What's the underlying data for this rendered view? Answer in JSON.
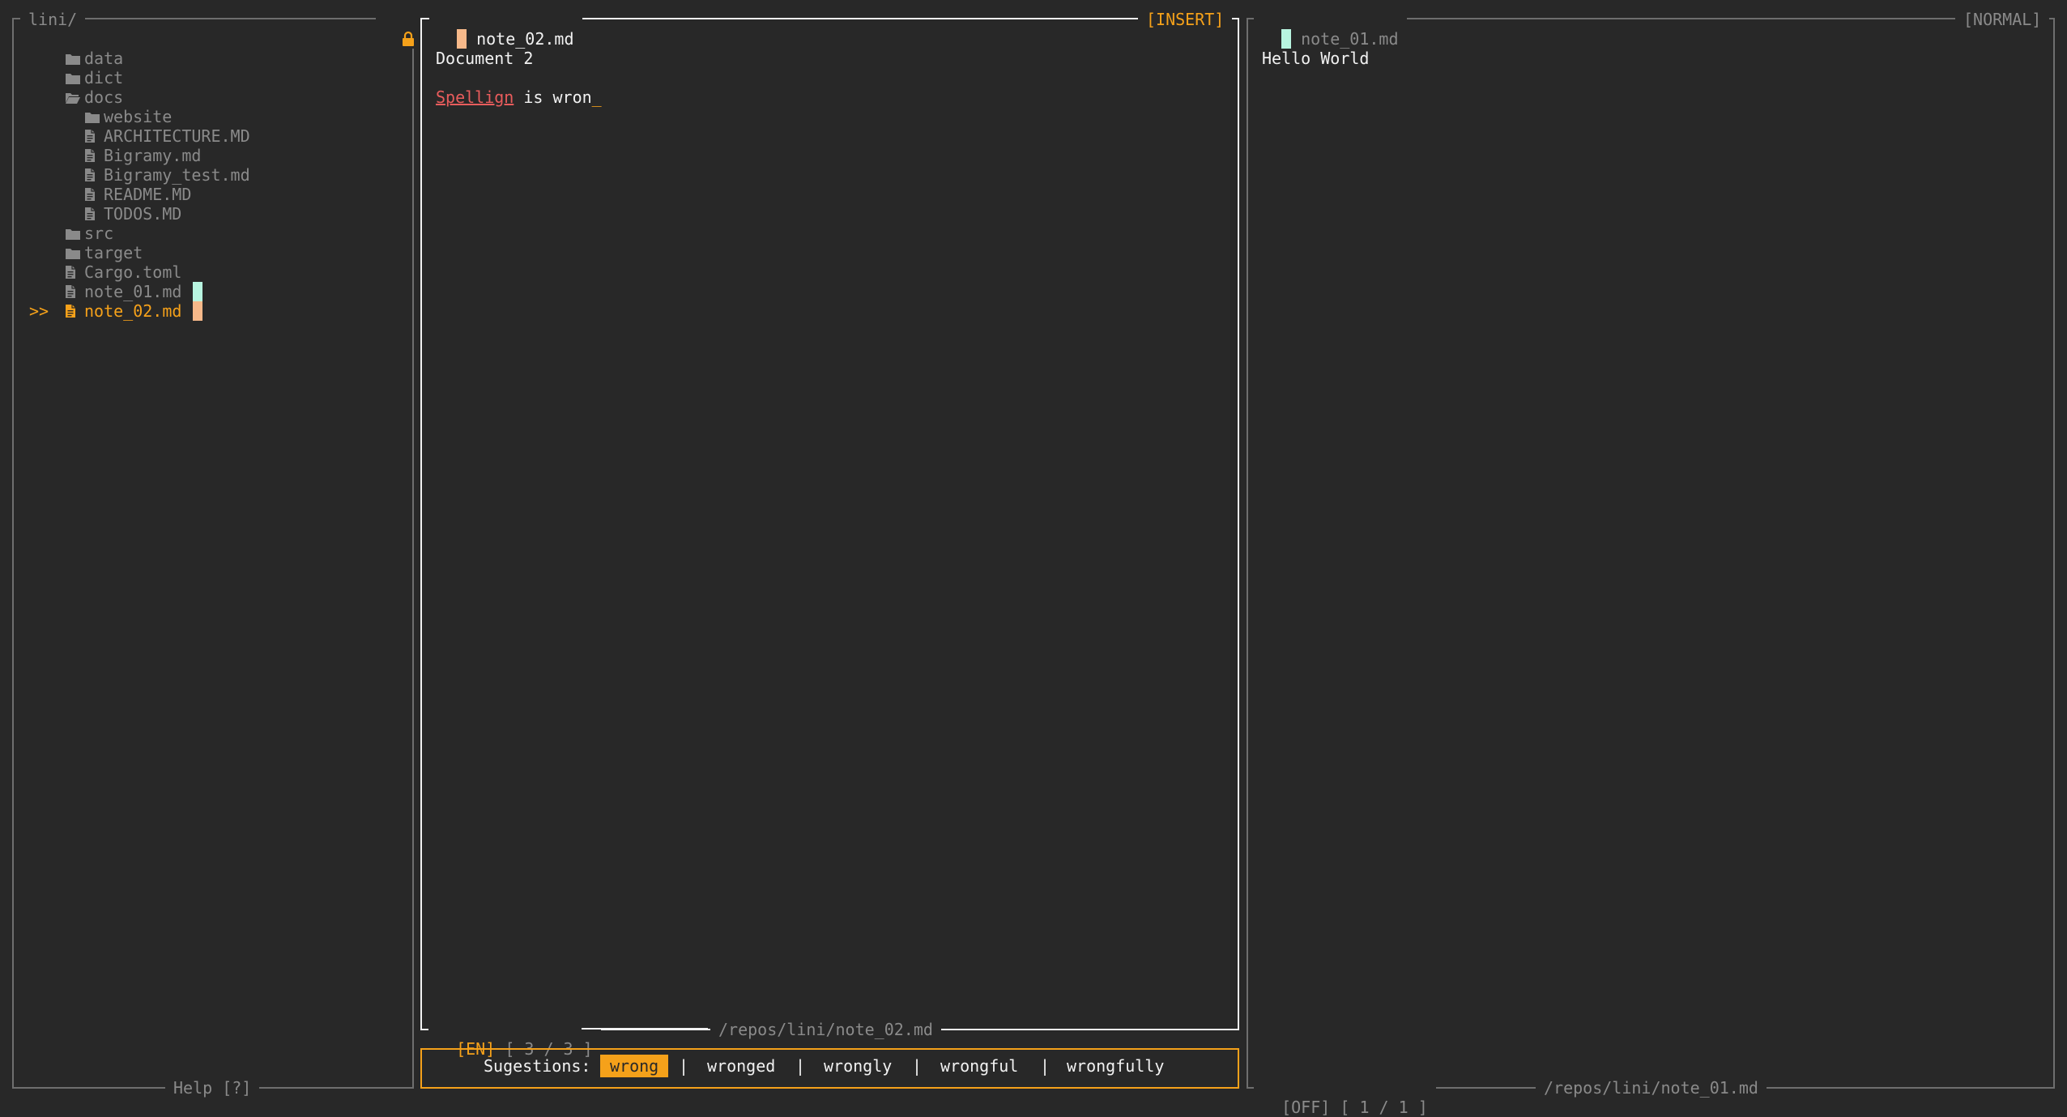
{
  "colors": {
    "background": "#282828",
    "accent": "#f5a11a",
    "text": "#f2f2f2",
    "dim": "#8a8a8a",
    "border_dim": "#6e6e6e",
    "marker_mint": "#b8f5e0",
    "marker_peach": "#f7b98a",
    "spell_error": "#e85c5c"
  },
  "explorer": {
    "title": "lini/",
    "lock_icon": "lock-icon",
    "help": "Help [?]",
    "selection_marker": ">>",
    "items": [
      {
        "name": "data",
        "type": "folder"
      },
      {
        "name": "dict",
        "type": "folder"
      },
      {
        "name": "docs",
        "type": "folder-open"
      },
      {
        "name": "website",
        "type": "folder"
      },
      {
        "name": "ARCHITECTURE.MD",
        "type": "file"
      },
      {
        "name": "Bigramy.md",
        "type": "file"
      },
      {
        "name": "Bigramy_test.md",
        "type": "file"
      },
      {
        "name": "README.MD",
        "type": "file"
      },
      {
        "name": "TODOS.MD",
        "type": "file"
      },
      {
        "name": "src",
        "type": "folder"
      },
      {
        "name": "target",
        "type": "folder"
      },
      {
        "name": "Cargo.toml",
        "type": "file"
      },
      {
        "name": "note_01.md",
        "type": "file"
      },
      {
        "name": "note_02.md",
        "type": "file"
      }
    ]
  },
  "editor_left": {
    "filename": "note_02.md",
    "mode": "[INSERT]",
    "line1": "Document 2",
    "misspelled": "Spellign",
    "rest": " is wron",
    "cursor": "_",
    "lang": "[EN]",
    "position": "[ 3 / 3 ]",
    "path": "/repos/lini/note_02.md"
  },
  "suggestions": {
    "label": "Sugestions:",
    "selected": "wrong",
    "items": [
      "wronged",
      "wrongly",
      "wrongful",
      "wrongfully"
    ],
    "separator": "|"
  },
  "editor_right": {
    "filename": "note_01.md",
    "mode": "[NORMAL]",
    "line1": "Hello World",
    "lang": "[OFF]",
    "position": "[ 1 / 1 ]",
    "path": "/repos/lini/note_01.md"
  }
}
